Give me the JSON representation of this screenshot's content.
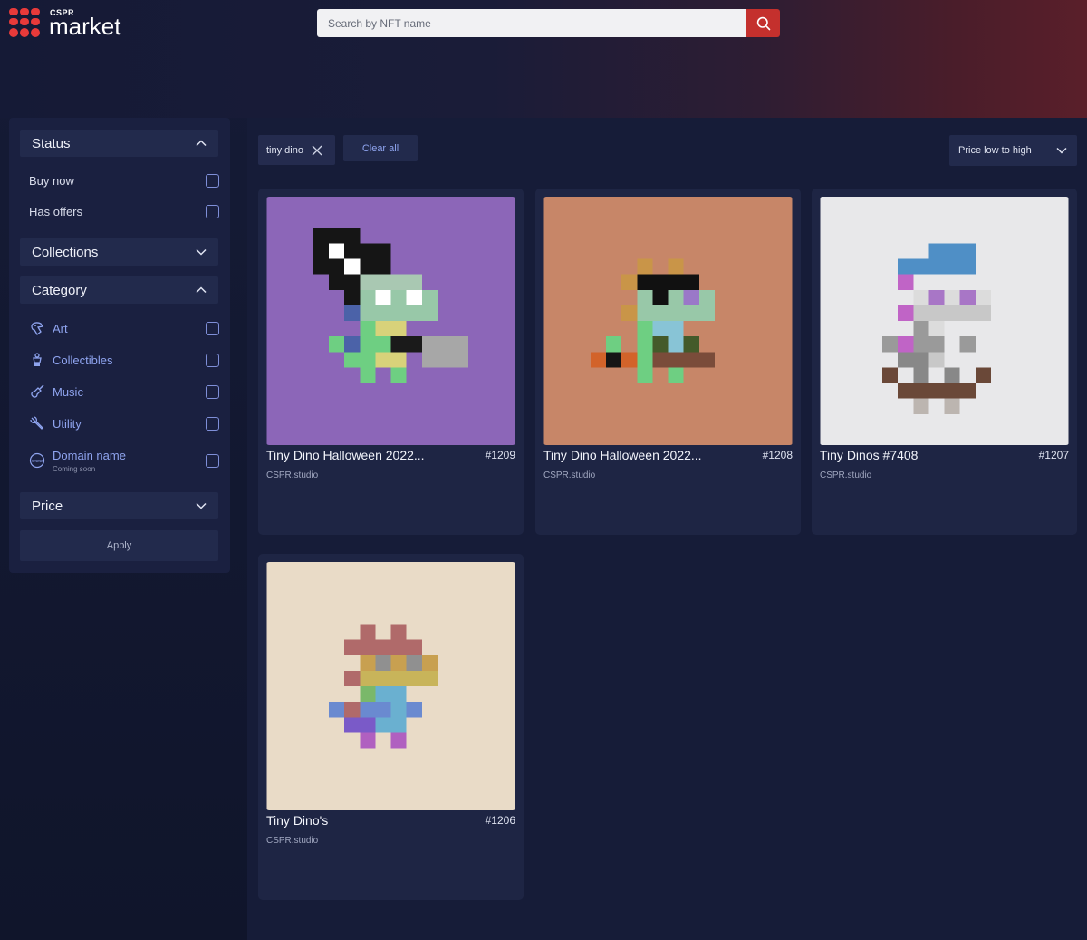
{
  "header": {
    "logo_small": "CSPR",
    "logo_main": "market",
    "search_placeholder": "Search by NFT name"
  },
  "sidebar": {
    "status": {
      "title": "Status",
      "options": [
        {
          "label": "Buy now"
        },
        {
          "label": "Has offers"
        }
      ]
    },
    "collections": {
      "title": "Collections"
    },
    "category": {
      "title": "Category",
      "items": [
        {
          "label": "Art",
          "icon": "art-palette-icon"
        },
        {
          "label": "Collectibles",
          "icon": "trophy-icon"
        },
        {
          "label": "Music",
          "icon": "guitar-icon"
        },
        {
          "label": "Utility",
          "icon": "wrench-icon"
        },
        {
          "label": "Domain name",
          "sublabel": "Coming soon",
          "icon": "www-globe-icon"
        }
      ]
    },
    "price": {
      "title": "Price"
    },
    "apply_label": "Apply"
  },
  "filters": {
    "active_chip": "tiny dino",
    "clear_label": "Clear all",
    "sort_label": "Price low to high"
  },
  "cards": [
    {
      "name": "Tiny Dino Halloween 2022...",
      "id": "#1209",
      "creator": "CSPR.studio",
      "bg": "#8c66b8"
    },
    {
      "name": "Tiny Dino Halloween 2022...",
      "id": "#1208",
      "creator": "CSPR.studio",
      "bg": "#c78668"
    },
    {
      "name": "Tiny Dinos #7408",
      "id": "#1207",
      "creator": "CSPR.studio",
      "bg": "#e8e8ea"
    },
    {
      "name": "Tiny Dino's",
      "id": "#1206",
      "creator": "CSPR.studio",
      "bg": "#e9dbc7"
    }
  ],
  "colors": {
    "accent_red": "#c4302d",
    "link_blue": "#8fa4ef",
    "panel": "#1a2040"
  }
}
